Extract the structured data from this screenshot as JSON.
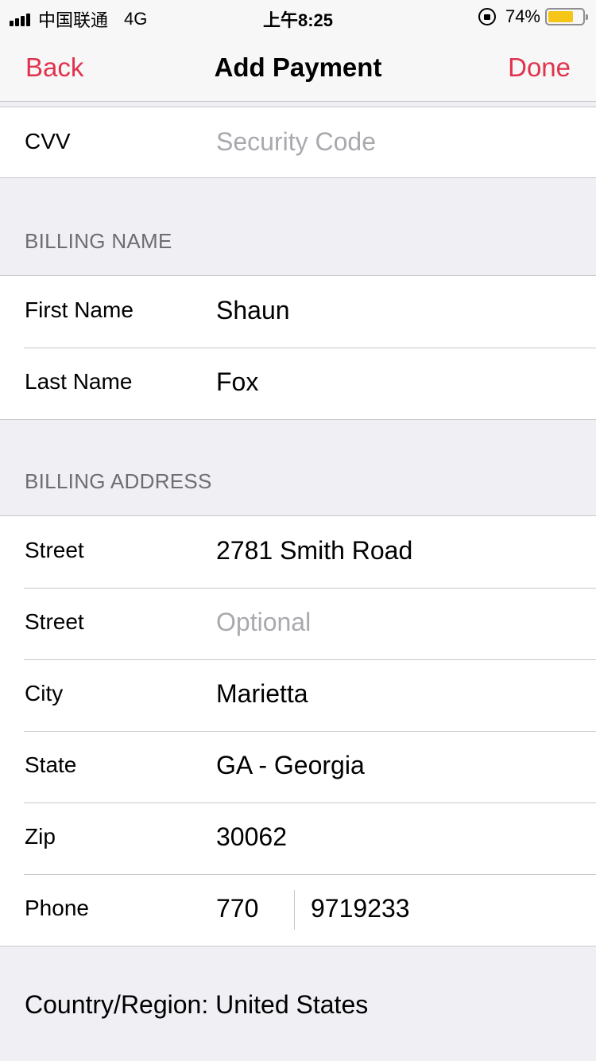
{
  "status_bar": {
    "carrier": "中国联通",
    "network": "4G",
    "time": "上午8:25",
    "battery_percent_text": "74%",
    "battery_level": 0.74,
    "battery_color": "#f5c518"
  },
  "nav": {
    "back_label": "Back",
    "title": "Add Payment",
    "done_label": "Done",
    "accent_color": "#e0334e"
  },
  "card": {
    "cvv_label": "CVV",
    "cvv_placeholder": "Security Code"
  },
  "billing_name": {
    "header": "BILLING NAME",
    "first_name_label": "First Name",
    "first_name_value": "Shaun",
    "last_name_label": "Last Name",
    "last_name_value": "Fox"
  },
  "billing_address": {
    "header": "BILLING ADDRESS",
    "street1_label": "Street",
    "street1_value": "2781 Smith Road",
    "street2_label": "Street",
    "street2_placeholder": "Optional",
    "city_label": "City",
    "city_value": "Marietta",
    "state_label": "State",
    "state_value": "GA - Georgia",
    "zip_label": "Zip",
    "zip_value": "30062",
    "phone_label": "Phone",
    "phone_area": "770",
    "phone_number": "9719233"
  },
  "country_region": "Country/Region: United States"
}
